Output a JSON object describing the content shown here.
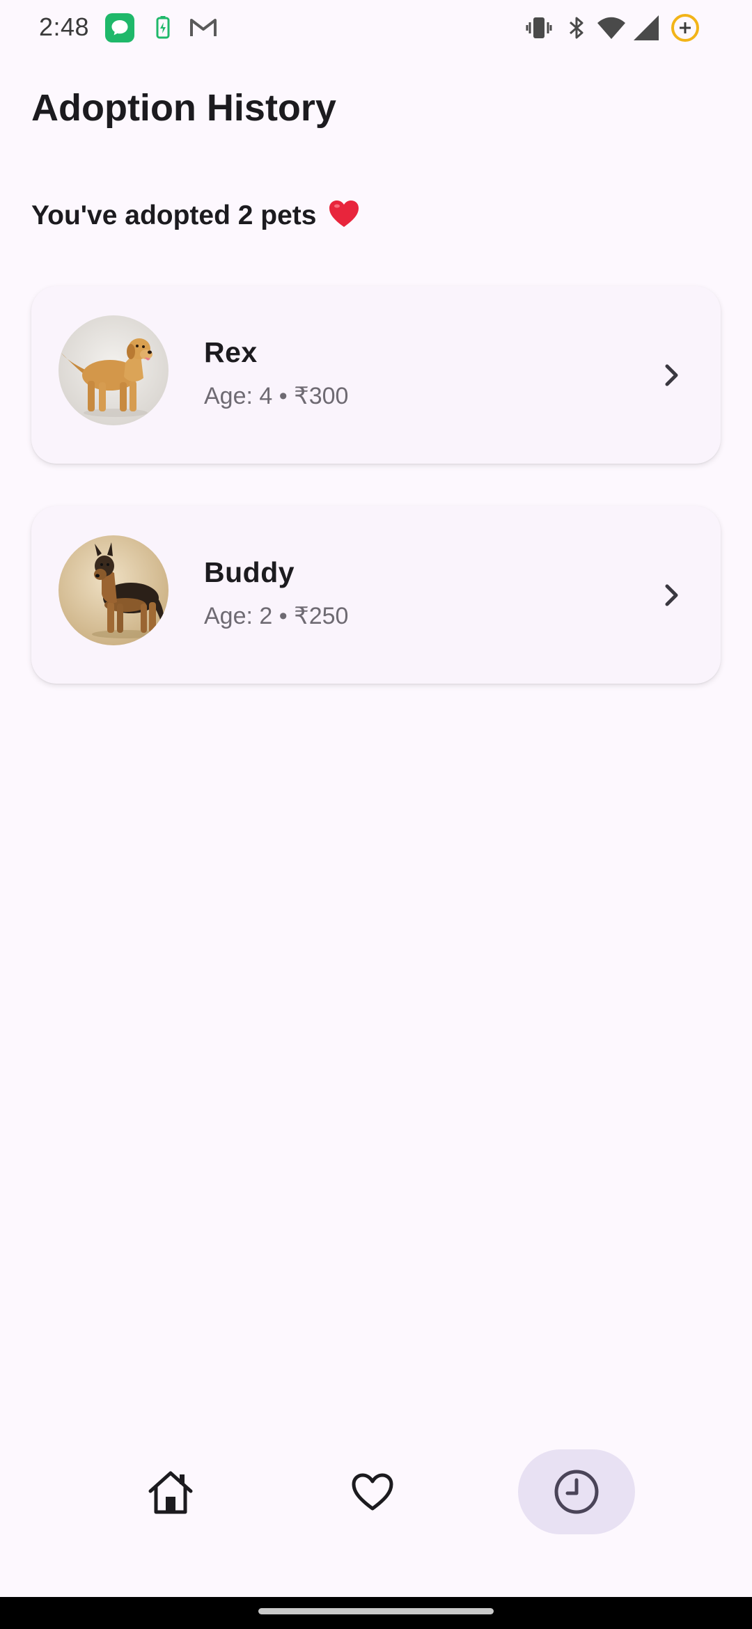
{
  "status_bar": {
    "time": "2:48",
    "icons": [
      "messages-icon",
      "battery-saver-icon",
      "gmail-icon",
      "vibrate-icon",
      "bluetooth-icon",
      "wifi-icon",
      "signal-icon",
      "battery-add-icon"
    ]
  },
  "page": {
    "title": "Adoption History",
    "summary": "You've adopted 2 pets",
    "summary_emoji": "❤️"
  },
  "pets": [
    {
      "name": "Rex",
      "meta": "Age: 4 • ₹300",
      "photo": "golden-retriever-photo"
    },
    {
      "name": "Buddy",
      "meta": "Age: 2 • ₹250",
      "photo": "german-shepherd-photo"
    }
  ],
  "bottom_nav": {
    "items": [
      {
        "icon": "home-icon",
        "active": false
      },
      {
        "icon": "heart-icon",
        "active": false
      },
      {
        "icon": "history-clock-icon",
        "active": true
      }
    ]
  },
  "colors": {
    "background": "#fdf8fe",
    "card": "#faf4fc",
    "active_nav": "#e8e1f3",
    "active_icon": "#4a4458",
    "muted_text": "#6e6a72"
  }
}
